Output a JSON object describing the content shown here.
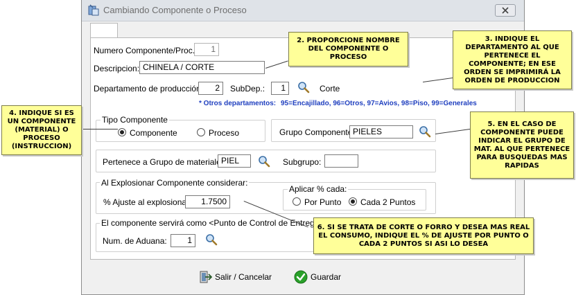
{
  "window": {
    "title": "Cambiando Componente o Proceso"
  },
  "form": {
    "numero_label": "Numero Componente/Proc.:",
    "numero_value": "1",
    "descripcion_label": "Descripcion:",
    "descripcion_value": "CHINELA / CORTE",
    "departamento_label": "Departamento de producción:",
    "departamento_value": "2",
    "subdep_label": "SubDep.:",
    "subdep_value": "1",
    "subdep_name": "Corte",
    "otros_departamentos": "* Otros departamentos:",
    "otros_list": "95=Encajillado, 96=Otros, 97=Avios,      98=Piso,     99=Generales",
    "tipo_title": "Tipo Componente",
    "tipo_options": [
      "Componente",
      "Proceso"
    ],
    "tipo_selected": "Componente",
    "grupo_componente_label": "Grupo Componente:",
    "grupo_componente_value": "PIELES",
    "grupo_materiales_label": "Pertenece a Grupo de materiales:",
    "grupo_materiales_value": "PIEL",
    "subgrupo_label": "Subgrupo:",
    "subgrupo_value": "",
    "explosion_title": "Al Explosionar Componente considerar:",
    "ajuste_label": "% Ajuste al explosionar:",
    "ajuste_value": "1.7500",
    "aplicar_title": "Aplicar % cada:",
    "aplicar_options": [
      "Por Punto",
      "Cada 2 Puntos"
    ],
    "aplicar_selected": "Cada 2 Puntos",
    "punto_control_title": "El componente servirá  como <Punto de Control de Entregas o In",
    "aduana_label": "Num. de Aduana:",
    "aduana_value": "1"
  },
  "buttons": {
    "salir_label": "Salir / Cancelar",
    "guardar_label": "Guardar"
  },
  "callouts": {
    "c2": "2. PROPORCIONE NOMBRE DEL COMPONENTE O PROCESO",
    "c3": "3. INDIQUE EL DEPARTAMENTO AL QUE PERTENECE EL COMPONENTE; EN ESE ORDEN SE IMPRIMIRÁ LA ORDEN DE PRODUCCION",
    "c4": "4. INDIQUE SI ES UN COMPONENTE (MATERIAL) O PROCESO (INSTRUCCION)",
    "c5": "5. EN EL CASO DE COMPONENTE PUEDE INDICAR EL GRUPO DE MAT. AL QUE PERTENECE PARA BUSQUEDAS MAS RAPIDAS",
    "c6": "6. SI SE TRATA DE CORTE O FORRO Y DESEA MAS REAL EL CONSUMO, INDIQUE EL % DE AJUSTE POR PUNTO O CADA 2 PUNTOS SI ASI LO DESEA"
  },
  "colors": {
    "callout_bg": "#ffff99",
    "note_blue": "#1f3fbf",
    "save_green": "#2aa12a"
  },
  "icons": {
    "title": "app-icon",
    "search": "search-icon",
    "exit": "exit-icon",
    "save": "checkmark-icon"
  }
}
